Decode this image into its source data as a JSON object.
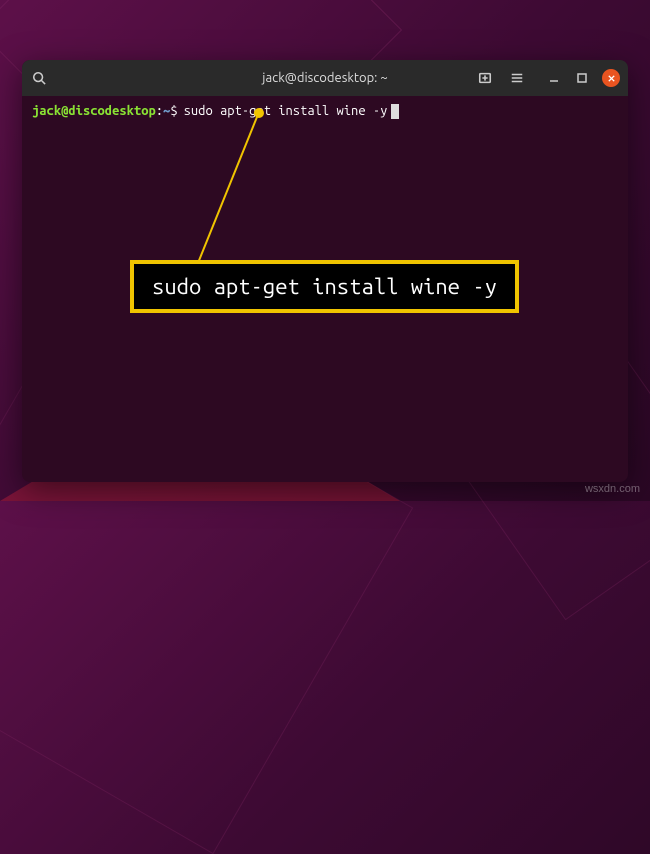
{
  "titlebar": {
    "title": "jack@discodesktop: ~"
  },
  "terminal": {
    "prompt_user_host": "jack@discodesktop",
    "prompt_colon": ":",
    "prompt_path": "~",
    "prompt_symbol": "$",
    "command": "sudo apt-get install wine -y"
  },
  "callout": {
    "text": "sudo apt-get install wine -y"
  },
  "watermark": "wsxdn.com"
}
